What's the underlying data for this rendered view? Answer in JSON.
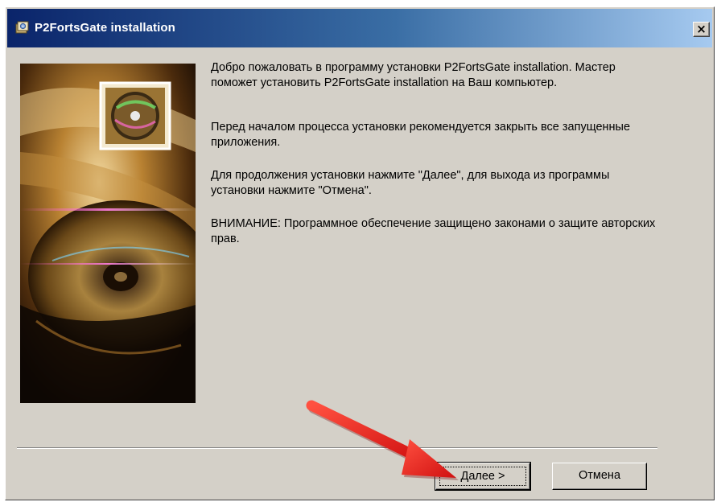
{
  "window": {
    "title": "P2FortsGate installation",
    "close_glyph": "×"
  },
  "welcome": {
    "paragraphs": [
      "Добро пожаловать в программу установки P2FortsGate installation. Мастер поможет установить P2FortsGate installation на Ваш компьютер.",
      "Перед началом процесса установки рекомендуется закрыть все запущенные приложения.",
      "Для продолжения установки нажмите \"Далее\",  для выхода из программы установки нажмите \"Отмена\".",
      "ВНИМАНИЕ: Программное обеспечение защищено законами о защите авторских прав."
    ]
  },
  "buttons": {
    "next_label": "Далее >",
    "cancel_label": "Отмена"
  },
  "colors": {
    "titlebar_start": "#0a246a",
    "titlebar_end": "#a6caf0",
    "window_face": "#d4d0c8",
    "annotation_arrow": "#e02020"
  },
  "icons": {
    "app": "installer-icon",
    "close": "close-icon",
    "annotation": "red-arrow-icon"
  }
}
